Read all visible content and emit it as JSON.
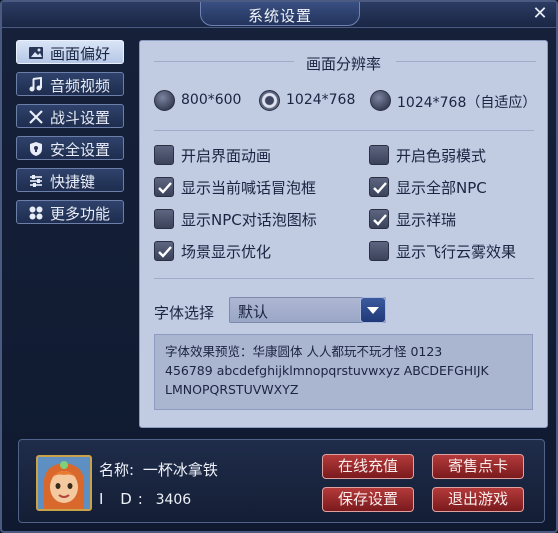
{
  "window": {
    "title": "系统设置",
    "close_label": "✕"
  },
  "sidebar": {
    "items": [
      {
        "label": "画面偏好",
        "icon": "image-icon",
        "active": true
      },
      {
        "label": "音频视频",
        "icon": "music-icon",
        "active": false
      },
      {
        "label": "战斗设置",
        "icon": "swords-icon",
        "active": false
      },
      {
        "label": "安全设置",
        "icon": "shield-icon",
        "active": false
      },
      {
        "label": "快捷键",
        "icon": "sliders-icon",
        "active": false
      },
      {
        "label": "更多功能",
        "icon": "grid-icon",
        "active": false
      }
    ]
  },
  "resolution": {
    "heading": "画面分辨率",
    "options": [
      {
        "label": "800*600",
        "selected": false
      },
      {
        "label": "1024*768",
        "selected": true
      },
      {
        "label": "1024*768（自适应）",
        "selected": false
      }
    ]
  },
  "options": [
    {
      "label": "开启界面动画",
      "checked": false
    },
    {
      "label": "开启色弱模式",
      "checked": false
    },
    {
      "label": "显示当前喊话冒泡框",
      "checked": true
    },
    {
      "label": "显示全部NPC",
      "checked": true
    },
    {
      "label": "显示NPC对话泡图标",
      "checked": false
    },
    {
      "label": "显示祥瑞",
      "checked": true
    },
    {
      "label": "场景显示优化",
      "checked": true
    },
    {
      "label": "显示飞行云雾效果",
      "checked": false
    }
  ],
  "font": {
    "label": "字体选择",
    "value": "默认",
    "preview_line1": "字体效果预览：华康圆体 人人都玩不玩才怪 0123",
    "preview_line2": "456789 abcdefghijklmnopqrstuvwxyz ABCDEFGHIJK",
    "preview_line3": "LMNOPQRSTUVWXYZ"
  },
  "player": {
    "name_label": "名称:",
    "name": "一杯冰拿铁",
    "id_label": "I D:",
    "id": "3406"
  },
  "actions": {
    "recharge": "在线充值",
    "consign": "寄售点卡",
    "save": "保存设置",
    "exit": "退出游戏"
  },
  "colors": {
    "accent_red": "#9c2a2c",
    "panel_bg": "#c1cbe2",
    "window_bg": "#16213a"
  }
}
